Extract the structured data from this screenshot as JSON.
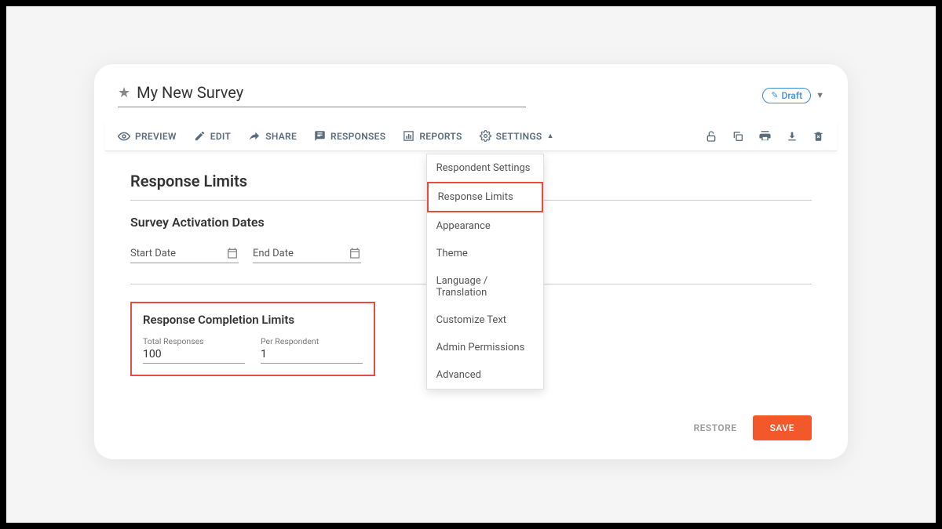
{
  "header": {
    "title": "My New Survey",
    "status_label": "Draft"
  },
  "toolbar": {
    "preview": "PREVIEW",
    "edit": "EDIT",
    "share": "SHARE",
    "responses": "RESPONSES",
    "reports": "REPORTS",
    "settings": "SETTINGS"
  },
  "settings_menu": {
    "items": [
      "Respondent Settings",
      "Response Limits",
      "Appearance",
      "Theme",
      "Language / Translation",
      "Customize Text",
      "Admin Permissions",
      "Advanced"
    ],
    "highlighted_index": 1
  },
  "content": {
    "page_title": "Response Limits",
    "activation_title": "Survey Activation Dates",
    "start_date_label": "Start Date",
    "end_date_label": "End Date",
    "completion_title": "Response Completion Limits",
    "total_responses_label": "Total Responses",
    "total_responses_value": "100",
    "per_respondent_label": "Per Respondent",
    "per_respondent_value": "1"
  },
  "footer": {
    "restore": "RESTORE",
    "save": "SAVE"
  }
}
